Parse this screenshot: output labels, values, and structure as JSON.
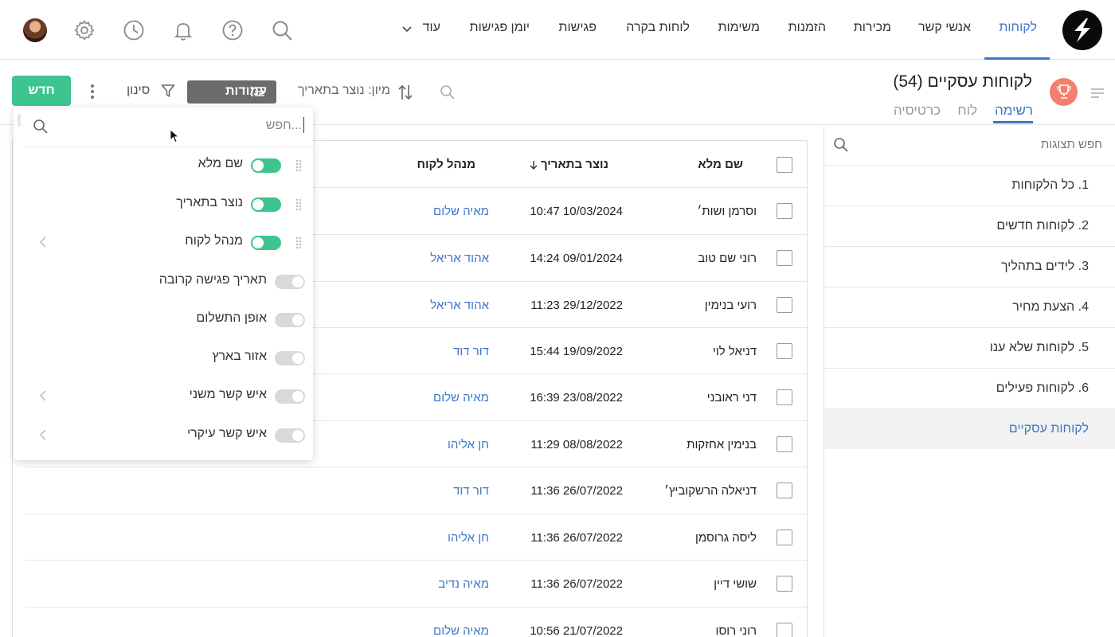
{
  "nav": {
    "items": [
      "לקוחות",
      "אנשי קשר",
      "מכירות",
      "הזמנות",
      "משימות",
      "לוחות בקרה",
      "פגישות",
      "יומן פגישות",
      "עוד"
    ],
    "active_index": 0
  },
  "header": {
    "title": "לקוחות עסקיים (54)",
    "view_tabs": [
      "רשימה",
      "לוח",
      "כרטיסיה"
    ],
    "active_view": 0
  },
  "toolbar": {
    "sort_label": "מיון: נוצר בתאריך",
    "columns_label": "עמודות",
    "filter_label": "סינון",
    "new_label": "חדש"
  },
  "sidebar": {
    "search_placeholder": "חפש תצוגות",
    "items": [
      "1. כל הלקוחות",
      "2. לקוחות חדשים",
      "3. לידים בתהליך",
      "4. הצעת מחיר",
      "5. לקוחות שלא ענו",
      "6. לקוחות פעילים",
      "לקוחות עסקיים"
    ],
    "active_index": 6
  },
  "table": {
    "columns": [
      "שם מלא",
      "נוצר בתאריך",
      "מנהל לקוח"
    ],
    "sorted_column": "נוצר בתאריך",
    "rows": [
      {
        "name": "וסרמן ושות׳",
        "created": "10:47 10/03/2024",
        "manager": "מאיה שלום"
      },
      {
        "name": "רוני שם טוב",
        "created": "14:24 09/01/2024",
        "manager": "אהוד אריאל"
      },
      {
        "name": "רועי בנימין",
        "created": "11:23 29/12/2022",
        "manager": "אהוד אריאל"
      },
      {
        "name": "דניאל לוי",
        "created": "15:44 19/09/2022",
        "manager": "דור דוד"
      },
      {
        "name": "דני ראובני",
        "created": "16:39 23/08/2022",
        "manager": "מאיה שלום"
      },
      {
        "name": "בנימין אחזקות",
        "created": "11:29 08/08/2022",
        "manager": "חן אליהו"
      },
      {
        "name": "דניאלה הרשקוביץ׳",
        "created": "11:36 26/07/2022",
        "manager": "דור דוד"
      },
      {
        "name": "ליסה גרוסמן",
        "created": "11:36 26/07/2022",
        "manager": "חן אליהו"
      },
      {
        "name": "שושי דיין",
        "created": "11:36 26/07/2022",
        "manager": "מאיה נדיב"
      },
      {
        "name": "רוני רוסו",
        "created": "10:56 21/07/2022",
        "manager": "מאיה שלום"
      }
    ]
  },
  "columns_menu": {
    "search_placeholder": "חפש...",
    "items": [
      {
        "label": "שם מלא",
        "enabled": true
      },
      {
        "label": "נוצר בתאריך",
        "enabled": true
      },
      {
        "label": "מנהל לקוח",
        "enabled": true
      },
      {
        "label": "תאריך פגישה קרובה",
        "enabled": false
      },
      {
        "label": "אופן התשלום",
        "enabled": false
      },
      {
        "label": "אזור בארץ",
        "enabled": false
      },
      {
        "label": "איש קשר משני",
        "enabled": false
      },
      {
        "label": "איש קשר עיקרי",
        "enabled": false
      }
    ]
  },
  "colors": {
    "accent": "#3d75c9",
    "primary_button": "#3ec48f",
    "toggle_on": "#3ec48f",
    "trophy": "#f47f6c"
  }
}
